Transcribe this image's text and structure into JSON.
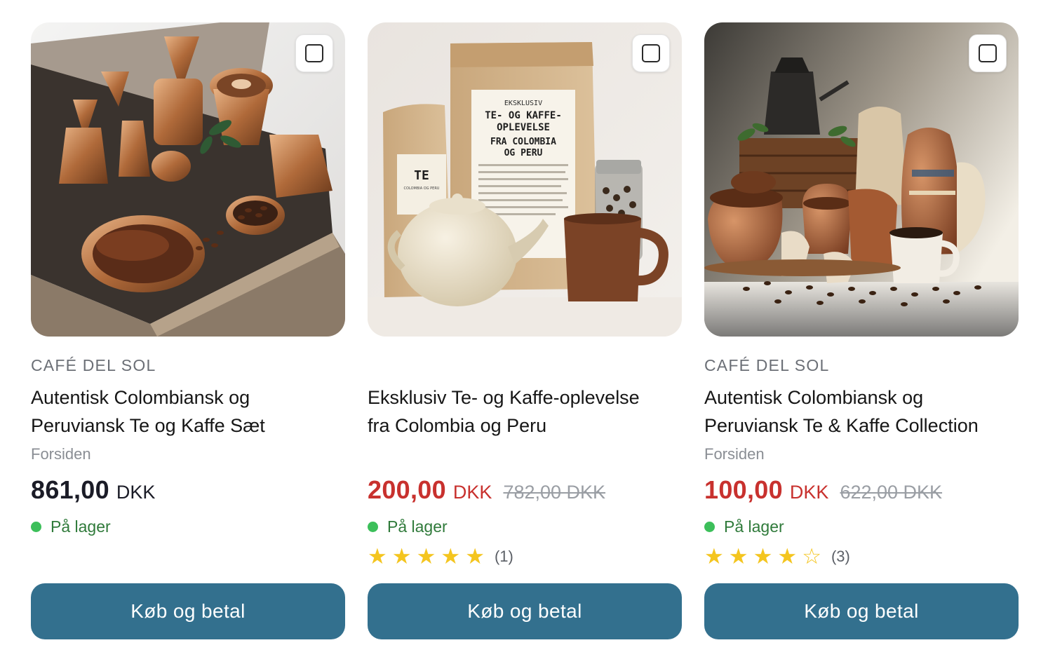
{
  "products": [
    {
      "vendor": "CAFÉ DEL SOL",
      "title_line1": "Autentisk Colombiansk og",
      "title_line2": "Peruviansk Te og Kaffe Sæt",
      "collection": "Forsiden",
      "price": "861,00",
      "currency": "DKK",
      "compare_at": "",
      "stock": "På lager",
      "rating_count": "",
      "buy_label": "Køb og betal"
    },
    {
      "vendor": "",
      "title_line1": "Eksklusiv Te- og Kaffe-oplevelse",
      "title_line2": "fra Colombia og Peru",
      "collection": "",
      "price": "200,00",
      "currency": "DKK",
      "compare_at": "782,00 DKK",
      "stock": "På lager",
      "rating_count": "(1)",
      "buy_label": "Køb og betal",
      "image_text": {
        "bag_top": "EKSKLUSIV",
        "bag_line1": "TE- OG KAFFE-",
        "bag_line2": "OPLEVELSE",
        "bag_line3": "FRA COLOMBIA",
        "bag_line4": "OG PERU",
        "small_bag": "TE",
        "small_bag_sub": "COLOMBIA OG PERU"
      }
    },
    {
      "vendor": "CAFÉ DEL SOL",
      "title_line1": "Autentisk Colombiansk og",
      "title_line2": "Peruviansk Te & Kaffe Collection",
      "collection": "Forsiden",
      "price": "100,00",
      "currency": "DKK",
      "compare_at": "622,00 DKK",
      "stock": "På lager",
      "rating_count": "(3)",
      "buy_label": "Køb og betal"
    }
  ],
  "ratings": [
    0,
    5,
    4
  ],
  "max_rating": 5,
  "colors": {
    "button": "#33708e",
    "sale_price": "#c8312e",
    "regular_price": "#1b1c27",
    "in_stock": "#3cbf5a",
    "star": "#f4c51f"
  },
  "icons": {
    "compare": "checkbox-icon",
    "stock": "status-dot-icon",
    "rating": "star-icon"
  }
}
